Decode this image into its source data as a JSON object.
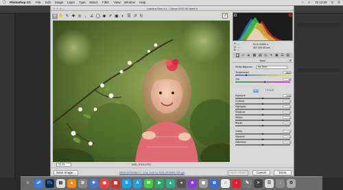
{
  "menubar": {
    "app_name": "Photoshop CC",
    "items": [
      "File",
      "Edit",
      "Image",
      "Layer",
      "Type",
      "Select",
      "Filter",
      "View",
      "Window",
      "Help"
    ],
    "clock": "Tri 12:09"
  },
  "dialog": {
    "title": "Camera Raw 9.1  -  Canon EOS 5D Mark II",
    "zoom": "33.4%",
    "filename": "IMG_8764.CR2",
    "buttons": {
      "save": "Save Image...",
      "open": "Open Object",
      "cancel": "Cancel",
      "done": "Done"
    },
    "workflow_link": "sRGB IEC61966-2.1; 8 bit; 4992 by 3328 (16.6MP); 300 ppi"
  },
  "camera_info": {
    "r_label": "R:",
    "g_label": "G:",
    "b_label": "B:",
    "r": "---",
    "g": "---",
    "b": "---",
    "aperture_shutter": "f/1.8   1/1600 s",
    "iso_focal": "ISO 200   85 mm"
  },
  "basic_panel": {
    "title": "Basic",
    "white_balance_label": "White Balance:",
    "white_balance_value": "As Shot",
    "auto_label": "Auto",
    "default_label": "Default",
    "temperature": {
      "label": "Temperature",
      "value": "4850",
      "position": 0.2
    },
    "tint": {
      "label": "Tint",
      "value": "+9",
      "position": 0.54
    },
    "sliders": [
      {
        "label": "Exposure",
        "value": "0.00",
        "position": 0.5
      },
      {
        "label": "Contrast",
        "value": "0",
        "position": 0.5
      },
      {
        "label": "Highlights",
        "value": "0",
        "position": 0.5
      },
      {
        "label": "Shadows",
        "value": "0",
        "position": 0.5
      },
      {
        "label": "Whites",
        "value": "0",
        "position": 0.5
      },
      {
        "label": "Blacks",
        "value": "0",
        "position": 0.5
      },
      {
        "label": "Clarity",
        "value": "0",
        "position": 0.5
      },
      {
        "label": "Vibrance",
        "value": "0",
        "position": 0.5
      },
      {
        "label": "Saturation",
        "value": "0",
        "position": 0.5
      }
    ]
  },
  "colors": {
    "link": "#1e4fcf",
    "dialog_bg": "#d7d7d7",
    "app_bg": "#2a2a2a"
  }
}
